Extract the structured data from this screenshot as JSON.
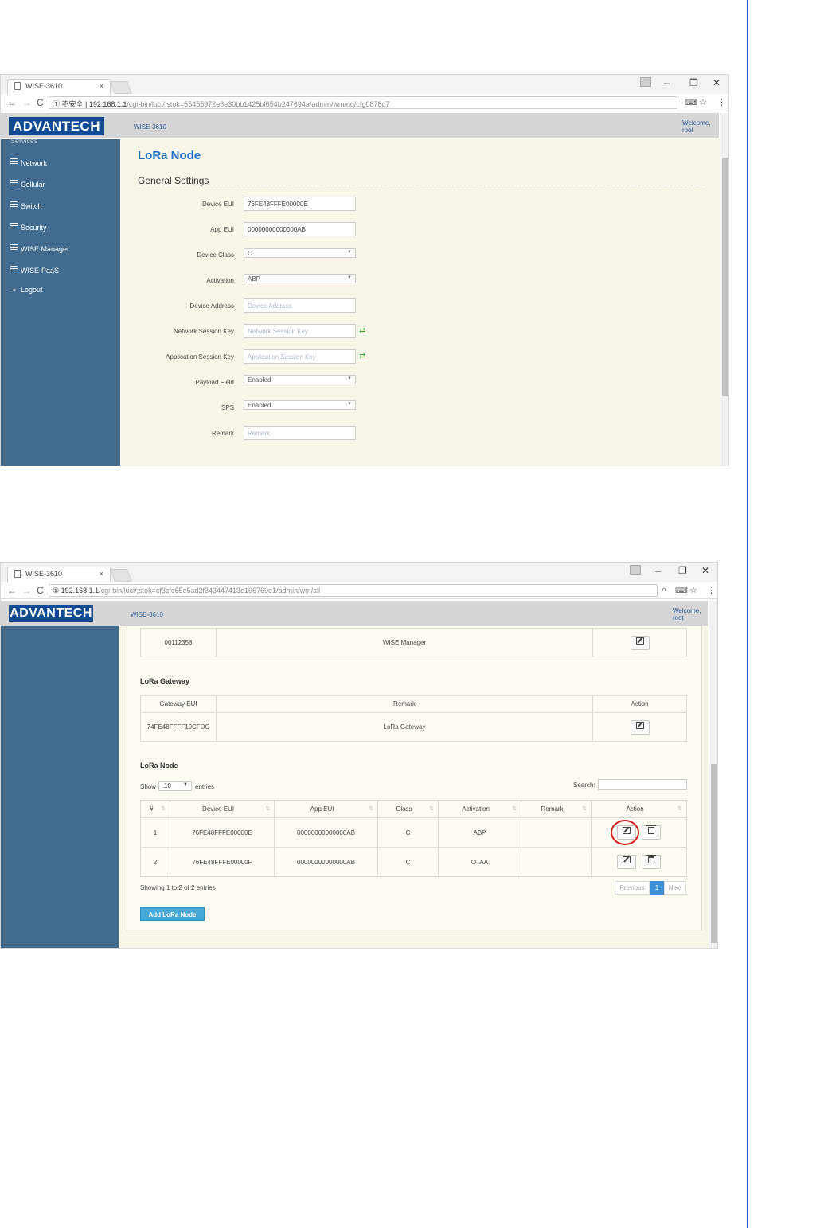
{
  "screen1": {
    "browser": {
      "tab_title": "WISE-3610",
      "tab_close": "×",
      "url_insecure": "① 不安全 |",
      "url_host": "192.168.1.1",
      "url_path": "/cgi-bin/luci/;stok=55455972e3e30bb1425bf654b247694a/admin/wm/nd/cfg0878d7"
    },
    "header": {
      "logo": "ADVANTECH",
      "model": "WISE-3610",
      "welcome_line1": "Welcome,",
      "welcome_line2": "root"
    },
    "sidebar": {
      "partial_item": "Services",
      "items": [
        "Network",
        "Cellular",
        "Switch",
        "Security",
        "WISE Manager",
        "WISE-PaaS",
        "Logout"
      ]
    },
    "page_title": "LoRa Node",
    "section_title": "General Settings",
    "form": {
      "device_eui": {
        "label": "Device EUI",
        "value": "76FE48FFFE00000E"
      },
      "app_eui": {
        "label": "App EUI",
        "value": "00000000000000AB"
      },
      "device_class": {
        "label": "Device Class",
        "value": "C"
      },
      "activation": {
        "label": "Activation",
        "value": "ABP"
      },
      "device_address": {
        "label": "Device Address",
        "placeholder": "Device Address"
      },
      "network_session_key": {
        "label": "Network Session Key",
        "placeholder": "Network Session Key"
      },
      "application_session_key": {
        "label": "Application Session Key",
        "placeholder": "Application Session Key"
      },
      "payload_field": {
        "label": "Payload Field",
        "value": "Enabled"
      },
      "sps": {
        "label": "SPS",
        "value": "Enabled"
      },
      "remark": {
        "label": "Remark",
        "placeholder": "Remark"
      }
    }
  },
  "screen2": {
    "browser": {
      "tab_title": "WISE-3610",
      "tab_close": "×",
      "url_insecure": "①",
      "url_host": "192.168.1.1",
      "url_path": "/cgi-bin/luci/;stok=cf3cfc65e5ad2f343447413e196769e1/admin/wm/all"
    },
    "header": {
      "logo": "ADVANTECH",
      "model": "WISE-3610",
      "welcome_line1": "Welcome,",
      "welcome_line2": "root"
    },
    "manager_row": {
      "id": "00112358",
      "name": "WISE Manager"
    },
    "gateway": {
      "title": "LoRa Gateway",
      "headers": [
        "Gateway EUI",
        "Remark",
        "Action"
      ],
      "row": {
        "eui": "74FE48FFFF19CFDC",
        "remark": "LoRa Gateway"
      }
    },
    "node": {
      "title": "LoRa Node",
      "show_label": "Show",
      "entries_value": "10",
      "entries_label": "entries",
      "search_label": "Search:",
      "headers": [
        "#",
        "Device EUI",
        "App EUI",
        "Class",
        "Activation",
        "Remark",
        "Action"
      ],
      "rows": [
        {
          "num": "1",
          "device_eui": "76FE48FFFE00000E",
          "app_eui": "00000000000000AB",
          "class": "C",
          "activation": "ABP",
          "remark": ""
        },
        {
          "num": "2",
          "device_eui": "76FE48FFFE00000F",
          "app_eui": "00000000000000AB",
          "class": "C",
          "activation": "OTAA",
          "remark": ""
        }
      ],
      "info": "Showing 1 to 2 of 2 entries",
      "pager": {
        "previous": "Previous",
        "current": "1",
        "next": "Next"
      },
      "add_button": "Add LoRa Node"
    }
  }
}
